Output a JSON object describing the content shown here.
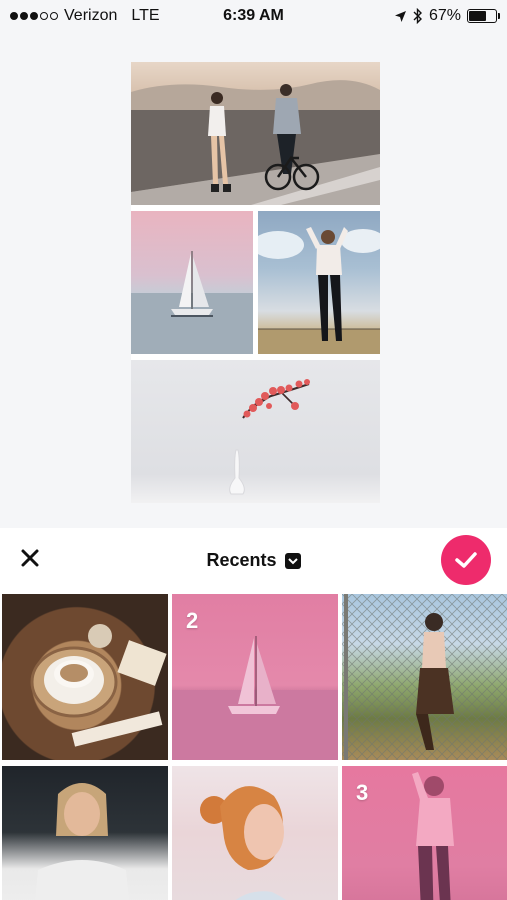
{
  "status_bar": {
    "carrier": "Verizon",
    "network": "LTE",
    "time": "6:39 AM",
    "battery": "67%",
    "battery_level": 0.67,
    "signal_bars_filled": 3,
    "signal_bars_total": 5
  },
  "toolbar": {
    "album_title": "Recents",
    "close_icon": "close-icon",
    "confirm_icon": "checkmark-icon",
    "accent_color": "#ee2b6c"
  },
  "photos": [
    {
      "label": ""
    },
    {
      "label": "2"
    },
    {
      "label": ""
    },
    {
      "label": ""
    },
    {
      "label": ""
    },
    {
      "label": "3"
    }
  ]
}
